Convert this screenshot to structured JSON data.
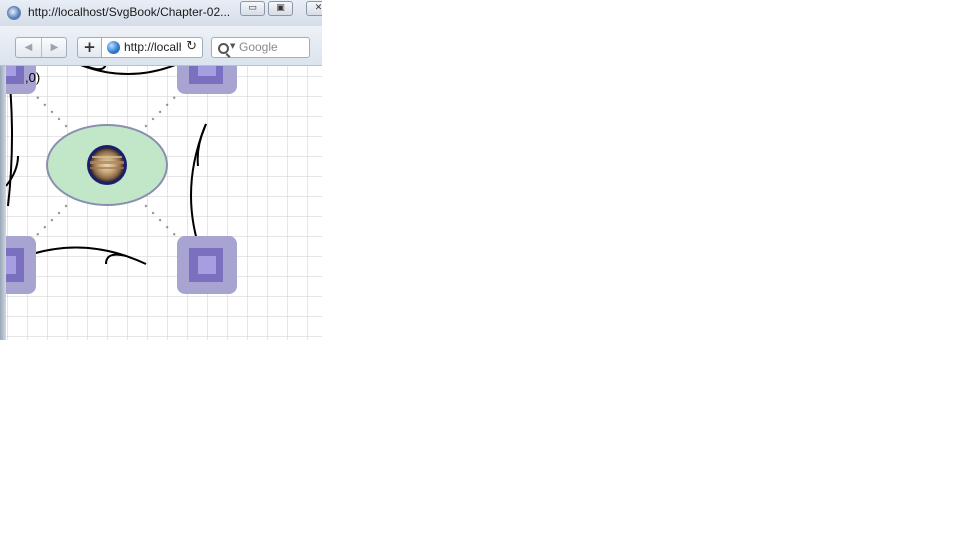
{
  "window": {
    "title": "http://localhost/SvgBook/Chapter-02...",
    "caption_buttons": {
      "minimize": "▭",
      "maximize": "▣",
      "close": "✕"
    }
  },
  "navbar": {
    "back_icon": "back-arrow-icon",
    "forward_icon": "forward-arrow-icon",
    "back_glyph": "◀",
    "forward_glyph": "▶",
    "add_label": "+",
    "url": "http://localhost/SvgBook/",
    "reload_glyph": "↻",
    "search_placeholder": "Google"
  },
  "canvas": {
    "coord_label": ",0)",
    "grid_color": "#cccccc",
    "ellipse_fill": "#c2e6c8",
    "ellipse_stroke": "#8a8fb0",
    "square_outer": "#a8a4d2",
    "square_mid": "#7a70bf",
    "square_inner": "#a59ee0"
  }
}
